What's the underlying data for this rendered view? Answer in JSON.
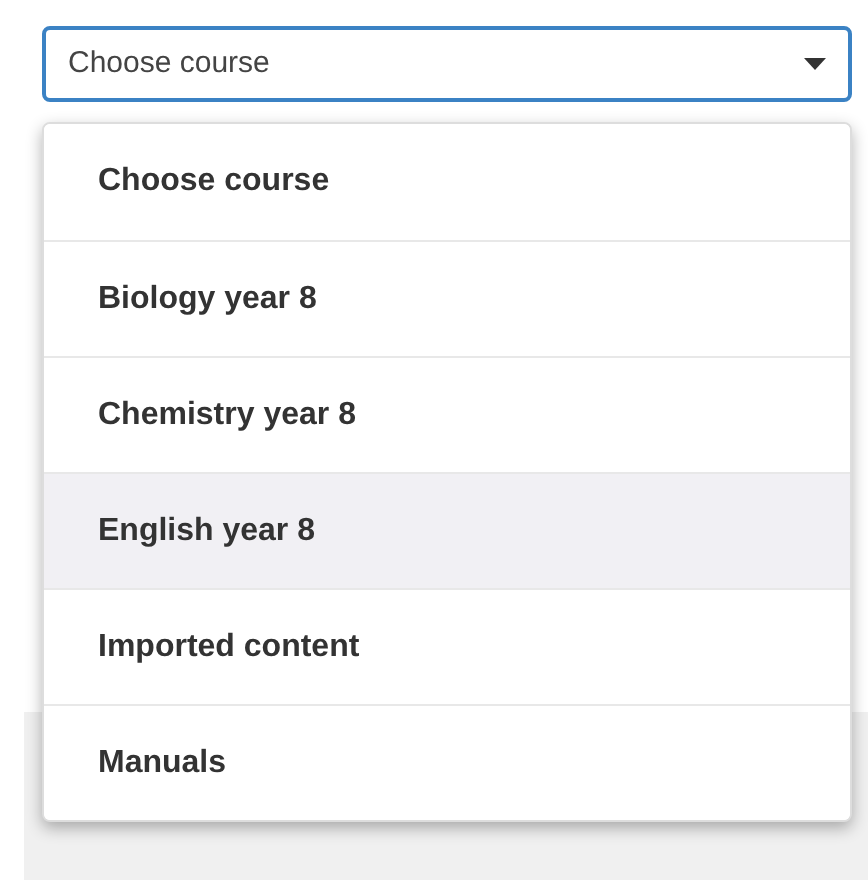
{
  "select": {
    "value": "Choose course"
  },
  "menu": {
    "items": [
      {
        "label": "Choose course",
        "selected": false
      },
      {
        "label": "Biology year 8",
        "selected": false
      },
      {
        "label": "Chemistry year 8",
        "selected": false
      },
      {
        "label": "English year 8",
        "selected": true
      },
      {
        "label": "Imported content",
        "selected": false
      },
      {
        "label": "Manuals",
        "selected": false
      }
    ]
  }
}
